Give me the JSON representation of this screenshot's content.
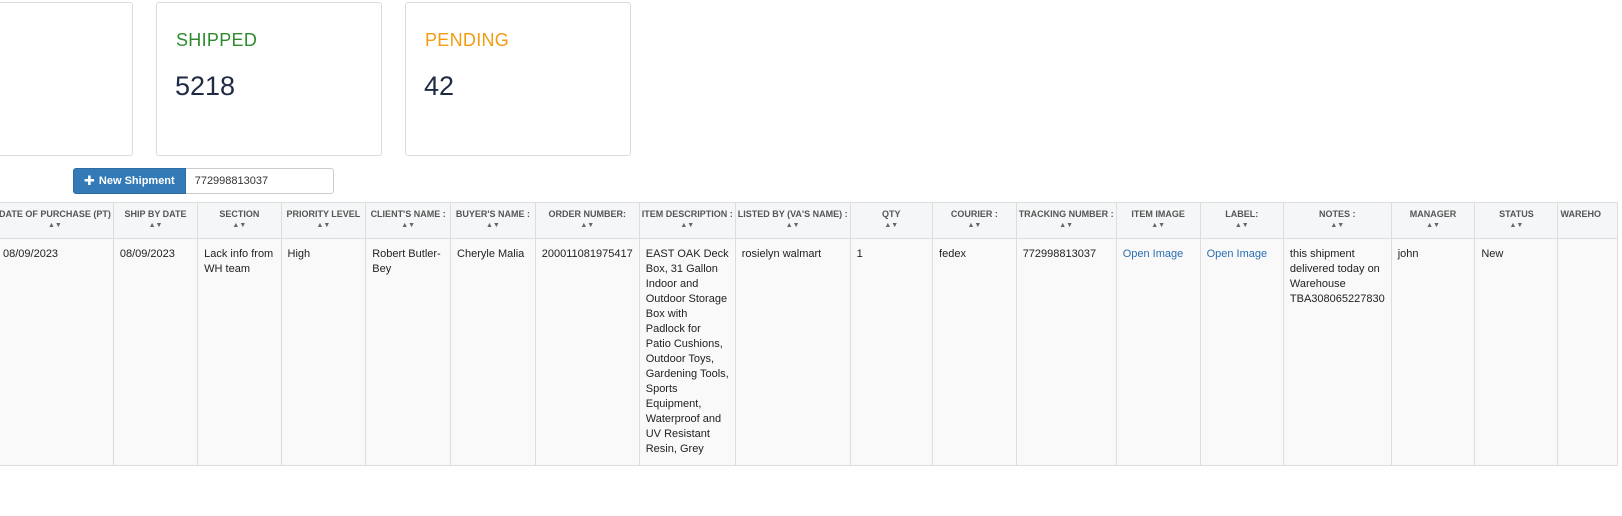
{
  "cards": [
    {
      "label": "",
      "value": ""
    },
    {
      "label": "SHIPPED",
      "value": "5218"
    },
    {
      "label": "PENDING",
      "value": "42"
    }
  ],
  "toolbar": {
    "new_shipment_label": "New Shipment",
    "search_value": "772998813037"
  },
  "table": {
    "headers": [
      "DATE OF PURCHASE (PT)",
      "SHIP BY DATE",
      "SECTION",
      "PRIORITY LEVEL",
      "CLIENT'S NAME :",
      "BUYER'S NAME :",
      "ORDER NUMBER:",
      "ITEM DESCRIPTION :",
      "LISTED BY (VA'S NAME) :",
      "QTY",
      "COURIER :",
      "TRACKING NUMBER :",
      "ITEM IMAGE",
      "LABEL:",
      "NOTES :",
      "MANAGER",
      "STATUS",
      "WAREHO"
    ],
    "row": {
      "date_of_purchase": "08/09/2023",
      "ship_by_date": "08/09/2023",
      "section": "Lack info from WH team",
      "priority": "High",
      "client_name": "Robert Butler-Bey",
      "buyer_name": "Cheryle Malia",
      "order_number": "200011081975417",
      "item_description": "EAST OAK Deck Box, 31 Gallon Indoor and Outdoor Storage Box with Padlock for Patio Cushions, Outdoor Toys, Gardening Tools, Sports Equipment, Waterproof and UV Resistant Resin, Grey",
      "listed_by": "rosielyn walmart",
      "qty": "1",
      "courier": "fedex",
      "tracking_number": "772998813037",
      "item_image_link": "Open Image",
      "label_link": "Open Image",
      "notes": "this shipment delivered today on Warehouse TBA308065227830",
      "manager": "john",
      "status": "New",
      "warehouse": ""
    }
  }
}
